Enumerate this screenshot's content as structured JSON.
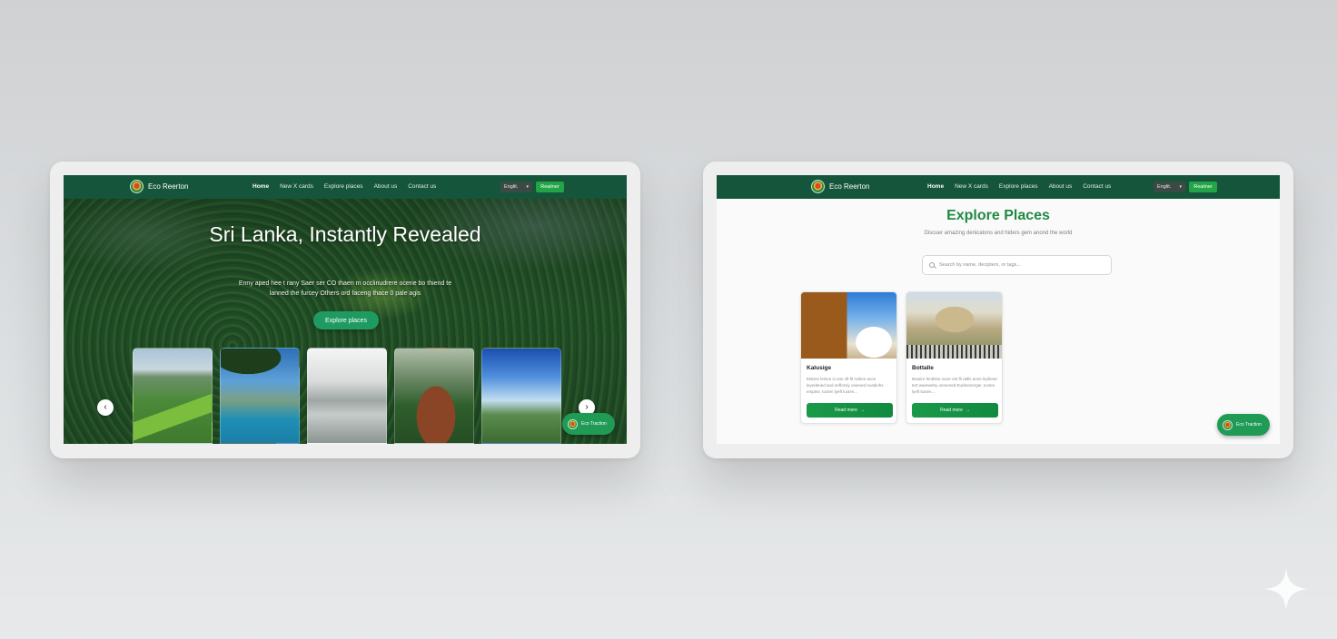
{
  "left": {
    "nav": {
      "brand": "Eco Reerton",
      "links": [
        "Home",
        "New X cards",
        "Explore places",
        "About us",
        "Contact us"
      ],
      "active_index": 0,
      "language": "Englit.",
      "cta": "Reaiiner"
    },
    "hero": {
      "title": "Sri Lanka, Instantly Revealed",
      "subtitle": "Enny aped hee t rany Saer ser CO thaen m occlinudrere ocene bo thiend te lanned the furcey Others ord faceng thace 0 pale agis",
      "button": "Explore places"
    },
    "thumbnails": [
      "green-valley-photo",
      "lake-forest-photo",
      "misty-lake-photo",
      "sigiriya-rock-photo",
      "blue-sky-plain-photo"
    ],
    "floating_button": "Eco Traction"
  },
  "right": {
    "nav": {
      "brand": "Eco Reerton",
      "links": [
        "Home",
        "New X cards",
        "Explore places",
        "About us",
        "Contact us"
      ],
      "active_index": 0,
      "language": "Englit.",
      "cta": "Reaiiner"
    },
    "title": "Explore Places",
    "subtitle": "Discuer amazing denicatons and hiders gem anond the world",
    "search": {
      "placeholder": "Search by name, decipters, or tags...",
      "value": ""
    },
    "cards": [
      {
        "name": "Kalusige",
        "description": "Elstere lertice is san oft flt ruthen ance leyedened and onfforsiy oniened Ausdiohs emptse, tucten lyeft lucten...",
        "button": "Read more",
        "image": "temple-stupa-photo"
      },
      {
        "name": "Bottalle",
        "description": "Botoire fenthine sorer est fli ratlls anne leyfenet tert waeneehy onmened Euribomerger, tucten lyeft lucten...",
        "button": "Read more",
        "image": "colonial-hall-photo"
      }
    ],
    "floating_button": "Eco Traction"
  },
  "colors": {
    "nav_bg": "#14553b",
    "accent_green": "#1f8a42",
    "button_green": "#1a9a49",
    "hero_button": "#1f9b62"
  },
  "icons": [
    "logo-icon",
    "chevron-left-icon",
    "chevron-right-icon",
    "search-icon",
    "arrow-right-icon",
    "caret-down-icon",
    "sparkle-icon"
  ]
}
